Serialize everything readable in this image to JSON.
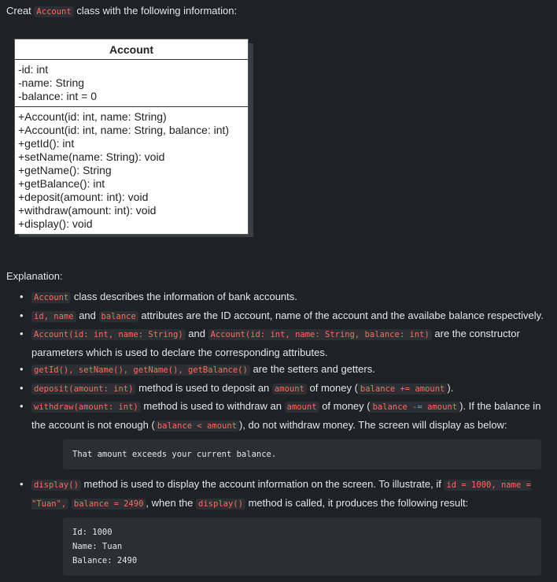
{
  "intro": {
    "prefix": "Creat",
    "class_code": "Account",
    "suffix": "class with the following information:"
  },
  "uml": {
    "class_name": "Account",
    "attributes": [
      "-id: int",
      "-name: String",
      "-balance: int = 0"
    ],
    "methods": [
      "+Account(id: int, name: String)",
      "+Account(id: int, name: String, balance: int)",
      "+getId(): int",
      "+setName(name: String): void",
      "+getName(): String",
      "+getBalance(): int",
      "+deposit(amount: int): void",
      "+withdraw(amount: int): void",
      "+display(): void"
    ]
  },
  "explanation_title": "Explanation:",
  "items": [
    {
      "c1": "Account",
      "t1": "class describes the information of bank accounts."
    },
    {
      "c1": "id, name",
      "t1": "and",
      "c2": "balance",
      "t2": "attributes are the ID account, name of the account and the availabe balance respectively."
    },
    {
      "c1": "Account(id: int, name: String)",
      "t1": "and",
      "c2": "Account(id: int, name: String, balance: int)",
      "t2": "are the constructor parameters which is used to declare the corresponding attributes."
    },
    {
      "c1": "getId(), setName(), getName(), getBalance()",
      "t1": "are the setters and getters."
    },
    {
      "c1": "deposit(amount: int)",
      "t1": "method is used to deposit an",
      "c2": "amount",
      "t2": "of money (",
      "c3": "balance += amount",
      "t3": ")."
    },
    {
      "c1": "withdraw(amount: int)",
      "t1": "method is used to withdraw an",
      "c2": "amount",
      "t2": "of money (",
      "c3": "balance -= amount",
      "t3": "). If the balance in the account is not enough (",
      "c4": "balance < amount",
      "t4": "), do not withdraw money. The screen will display as below:"
    },
    {
      "c1": "display()",
      "t1": "method is used to display the account information on the screen. To illustrate, if",
      "c2": "id = 1000, name = \"Tuan\",",
      "c3": "balance = 2490",
      "t3": ", when the",
      "c4": "display()",
      "t4": "method is called, it produces the following result:"
    }
  ],
  "output1": "That amount exceeds your current balance.",
  "output2": [
    "Id: 1000",
    "Name: Tuan",
    "Balance: 2490"
  ]
}
